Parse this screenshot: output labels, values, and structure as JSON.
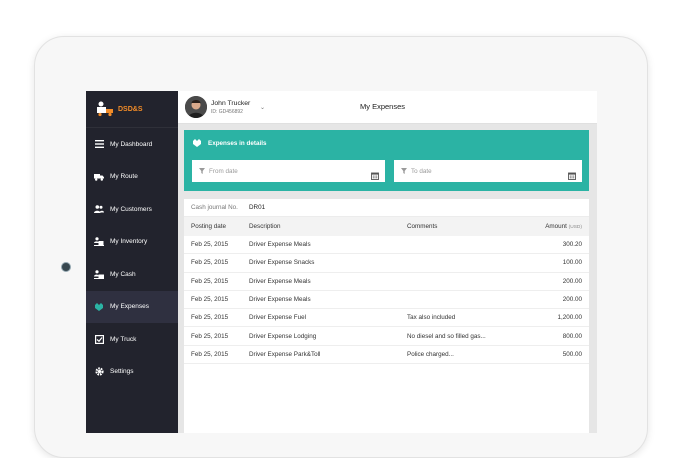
{
  "brand": {
    "logo_text": "DSD&S",
    "accent_color": "#f28c28"
  },
  "sidebar": {
    "items": [
      {
        "label": "My Dashboard",
        "icon": "menu-icon"
      },
      {
        "label": "My Route",
        "icon": "truck-icon"
      },
      {
        "label": "My Customers",
        "icon": "users-icon"
      },
      {
        "label": "My Inventory",
        "icon": "inventory-icon"
      },
      {
        "label": "My Cash",
        "icon": "cash-icon"
      },
      {
        "label": "My Expenses",
        "icon": "expenses-icon",
        "active": true
      },
      {
        "label": "My Truck",
        "icon": "checkbox-icon"
      },
      {
        "label": "Settings",
        "icon": "gear-icon"
      }
    ]
  },
  "header": {
    "user_name": "John Trucker",
    "user_id": "ID: GD456892",
    "page_title": "My Expenses"
  },
  "panel": {
    "title": "Expenses in details",
    "color": "#2bb3a4",
    "from_placeholder": "From date",
    "to_placeholder": "To date"
  },
  "table": {
    "journal_label": "Cash journal No.",
    "journal_value": "DR01",
    "columns": {
      "date": "Posting date",
      "desc": "Description",
      "comments": "Comments",
      "amount": "Amount",
      "unit": "(USD)"
    },
    "rows": [
      {
        "date": "Feb 25, 2015",
        "desc": "Driver Expense Meals",
        "comments": "",
        "amount": "300.20"
      },
      {
        "date": "Feb 25, 2015",
        "desc": "Driver Expense Snacks",
        "comments": "",
        "amount": "100.00"
      },
      {
        "date": "Feb 25, 2015",
        "desc": "Driver Expense Meals",
        "comments": "",
        "amount": "200.00"
      },
      {
        "date": "Feb 25, 2015",
        "desc": "Driver Expense Meals",
        "comments": "",
        "amount": "200.00"
      },
      {
        "date": "Feb 25, 2015",
        "desc": "Driver Expense Fuel",
        "comments": "Tax also included",
        "amount": "1,200.00"
      },
      {
        "date": "Feb 25, 2015",
        "desc": "Driver Expense Lodging",
        "comments": "No diesel and so filled gas...",
        "amount": "800.00"
      },
      {
        "date": "Feb 25, 2015",
        "desc": "Driver Expense Park&Toll",
        "comments": "Police charged...",
        "amount": "500.00"
      }
    ]
  }
}
